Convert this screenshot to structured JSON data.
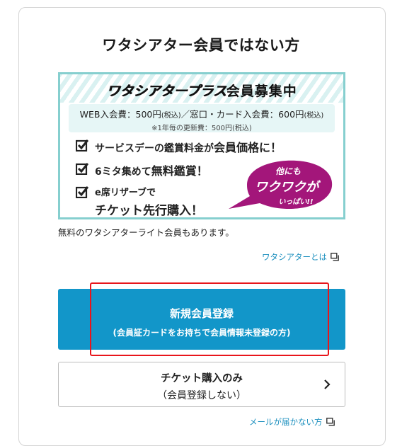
{
  "page": {
    "title": "ワタシアター会員ではない方"
  },
  "banner": {
    "brand": "ワタシアタープラス",
    "head_suffix": "会員募集中",
    "fee_web": "WEB入会費：500円",
    "fee_web_tax": "(税込)",
    "fee_counter": "／窓口・カード入会費：600円",
    "fee_counter_tax": "(税込)",
    "renewal_note": "※1年毎の更新費：500円(税込)",
    "features": [
      {
        "pre": "サービスデーの鑑賞料金が",
        "em": "会員価格に！"
      },
      {
        "pre": "6ミタ集めて",
        "em": "無料鑑賞！"
      },
      {
        "line1": "e席リザーブで",
        "line2": "チケット先行購入！"
      }
    ],
    "bubble": {
      "line1": "他にも",
      "line2": "ワクワクが",
      "line3": "いっぱい!!",
      "color": "#a3167a"
    },
    "border_color": "#86cfcf"
  },
  "lite_note": "無料のワタシアターライト会員もあります。",
  "about_link": "ワタシアターとは",
  "primary_button": {
    "line1": "新規会員登録",
    "line2": "(会員証カードをお持ちで会員情報未登録の方)",
    "color": "#1296c9"
  },
  "secondary_button": {
    "line1": "チケット購入のみ",
    "line2": "（会員登録しない）"
  },
  "mail_link": "メールが届かない方"
}
